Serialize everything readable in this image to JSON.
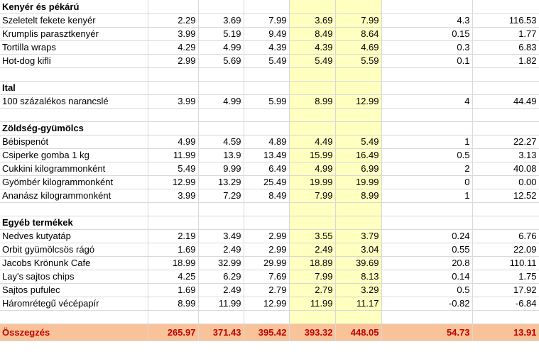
{
  "rows": [
    {
      "type": "section",
      "label": "Kenyér és pékárú"
    },
    {
      "type": "item",
      "label": "Szeletelt fekete kenyér",
      "v": [
        "2.29",
        "3.69",
        "7.99",
        "3.69",
        "7.99",
        "4.3",
        "116.53"
      ]
    },
    {
      "type": "item",
      "label": "Krumplis parasztkenyér",
      "v": [
        "3.99",
        "5.19",
        "9.49",
        "8.49",
        "8.64",
        "0.15",
        "1.77"
      ]
    },
    {
      "type": "item",
      "label": "Tortilla wraps",
      "v": [
        "4.29",
        "4.99",
        "4.39",
        "4.39",
        "4.69",
        "0.3",
        "6.83"
      ]
    },
    {
      "type": "item",
      "label": "Hot-dog kifli",
      "v": [
        "2.99",
        "5.69",
        "5.49",
        "5.49",
        "5.59",
        "0.1",
        "1.82"
      ]
    },
    {
      "type": "blank"
    },
    {
      "type": "section",
      "label": "Ital"
    },
    {
      "type": "item",
      "label": "100 százalékos narancslé",
      "v": [
        "3.99",
        "4.99",
        "5.99",
        "8.99",
        "12.99",
        "4",
        "44.49"
      ]
    },
    {
      "type": "blank"
    },
    {
      "type": "section",
      "label": "Zöldség-gyümölcs"
    },
    {
      "type": "item",
      "label": "Bébispenót",
      "v": [
        "4.99",
        "4.59",
        "4.89",
        "4.49",
        "5.49",
        "1",
        "22.27"
      ]
    },
    {
      "type": "item",
      "label": "Csiperke gomba 1 kg",
      "v": [
        "11.99",
        "13.9",
        "13.49",
        "15.99",
        "16.49",
        "0.5",
        "3.13"
      ]
    },
    {
      "type": "item",
      "label": "Cukkini kilogrammonként",
      "v": [
        "5.49",
        "9.99",
        "6.49",
        "4.99",
        "6.99",
        "2",
        "40.08"
      ]
    },
    {
      "type": "item",
      "label": "Gyömbér kilogrammonként",
      "v": [
        "12.99",
        "13.29",
        "25.49",
        "19.99",
        "19.99",
        "0",
        "0.00"
      ]
    },
    {
      "type": "item",
      "label": "Ananász kilogrammonként",
      "v": [
        "3.99",
        "7.29",
        "8.49",
        "7.99",
        "8.99",
        "1",
        "12.52"
      ]
    },
    {
      "type": "blank"
    },
    {
      "type": "section",
      "label": "Egyéb termékek"
    },
    {
      "type": "item",
      "label": "Nedves kutyatáp",
      "v": [
        "2.19",
        "3.49",
        "2.99",
        "3.55",
        "3.79",
        "0.24",
        "6.76"
      ]
    },
    {
      "type": "item",
      "label": "Orbit gyümölcsös rágó",
      "v": [
        "1.69",
        "2.49",
        "2.99",
        "2.49",
        "3.04",
        "0.55",
        "22.09"
      ]
    },
    {
      "type": "item",
      "label": "Jacobs Krönunk Cafe",
      "v": [
        "18.99",
        "32.99",
        "29.99",
        "18.89",
        "39.69",
        "20.8",
        "110.11"
      ]
    },
    {
      "type": "item",
      "label": "Lay's sajtos chips",
      "v": [
        "4.25",
        "6.29",
        "7.69",
        "7.99",
        "8.13",
        "0.14",
        "1.75"
      ]
    },
    {
      "type": "item",
      "label": "Sajtos pufulec",
      "v": [
        "1.69",
        "2.49",
        "2.79",
        "2.79",
        "3.29",
        "0.5",
        "17.92"
      ]
    },
    {
      "type": "item",
      "label": "Háromrétegű vécépapír",
      "v": [
        "8.99",
        "11.99",
        "12.99",
        "11.99",
        "11.17",
        "-0.82",
        "-6.84"
      ]
    },
    {
      "type": "blank"
    },
    {
      "type": "total",
      "label": "Összegzés",
      "v": [
        "265.97",
        "371.43",
        "395.42",
        "393.32",
        "448.05",
        "54.73",
        "13.91"
      ]
    }
  ]
}
